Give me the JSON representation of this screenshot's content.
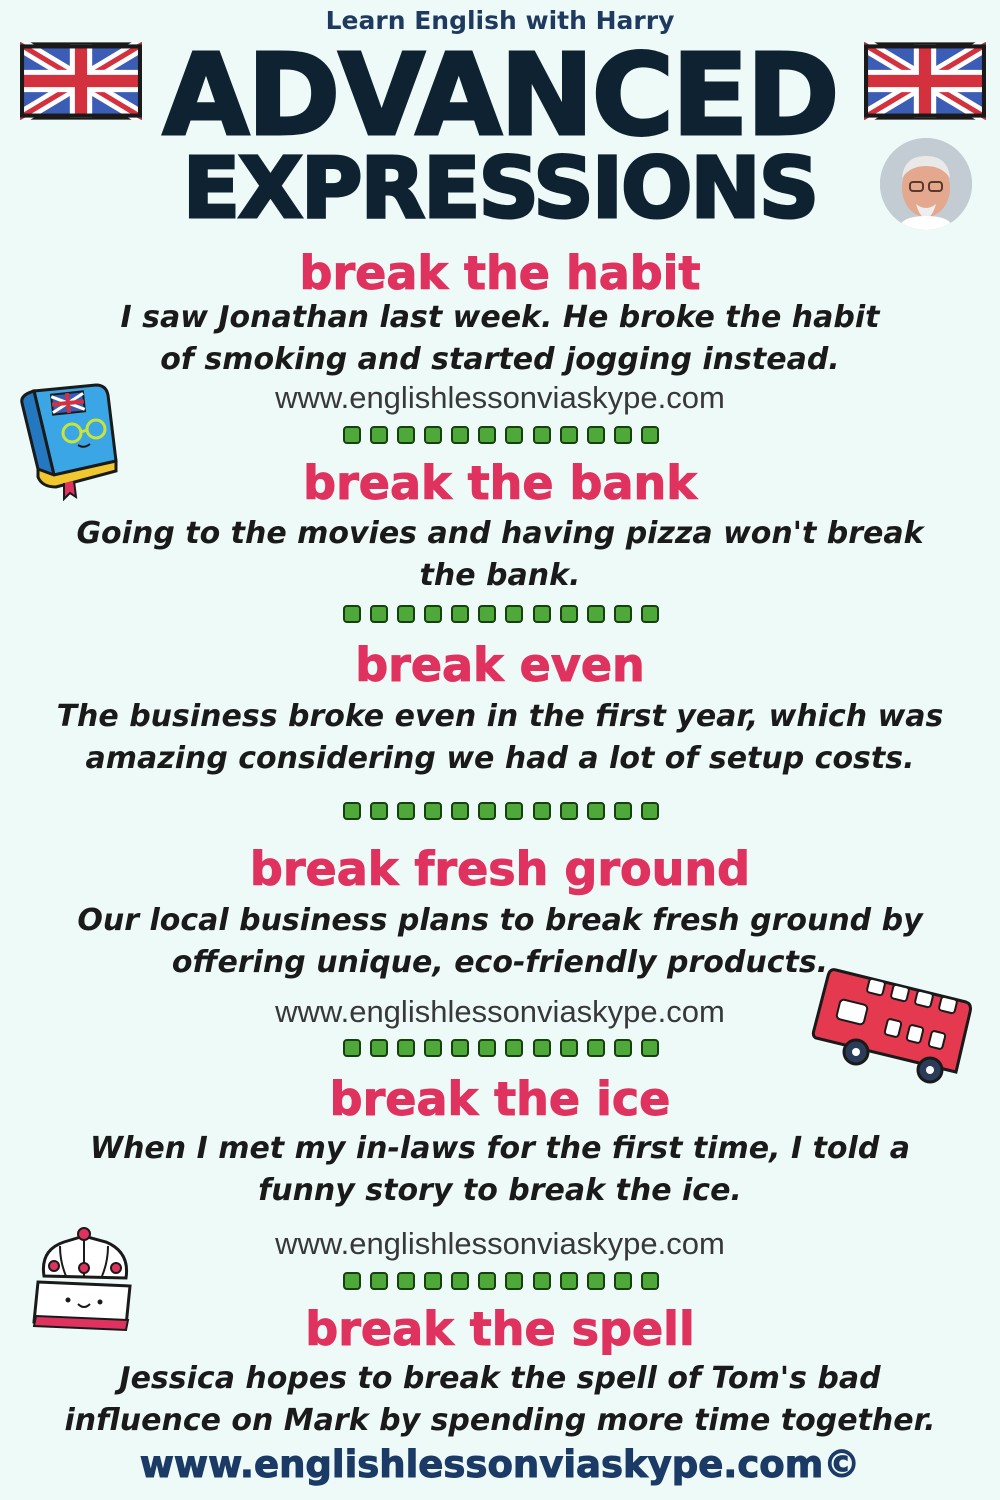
{
  "header": {
    "brand": "Learn English with Harry",
    "title_line1": "ADVANCED",
    "title_line2": "EXPRESSIONS"
  },
  "sections": [
    {
      "phrase": "break the habit",
      "example": "I saw Jonathan last week. He broke the habit of smoking and started jogging instead.",
      "url": "www.englishlessonviaskype.com"
    },
    {
      "phrase": "break the bank",
      "example": "Going to the movies and having pizza won't break the bank."
    },
    {
      "phrase": "break even",
      "example": "The business broke even in the first year, which was amazing considering we had a lot of setup costs."
    },
    {
      "phrase": "break fresh ground",
      "example": "Our local business plans to break fresh ground by offering unique, eco-friendly products.",
      "url": "www.englishlessonviaskype.com"
    },
    {
      "phrase": "break the ice",
      "example": "When I met my in-laws for the first time, I told a funny story to break the ice.",
      "url": "www.englishlessonviaskype.com"
    },
    {
      "phrase": "break the spell",
      "example": "Jessica hopes to break the spell of Tom's bad influence on Mark by spending more time together."
    }
  ],
  "footer": {
    "url": "www.englishlessonviaskype.com©"
  },
  "colors": {
    "background": "#eefaf8",
    "title": "#0f2231",
    "phrase": "#e0325e",
    "divider": "#4ea93a",
    "footer": "#1b3a66"
  },
  "icons": [
    "union-jack-flag-icon",
    "avatar-photo",
    "book-icon",
    "double-decker-bus-icon",
    "crown-icon"
  ]
}
